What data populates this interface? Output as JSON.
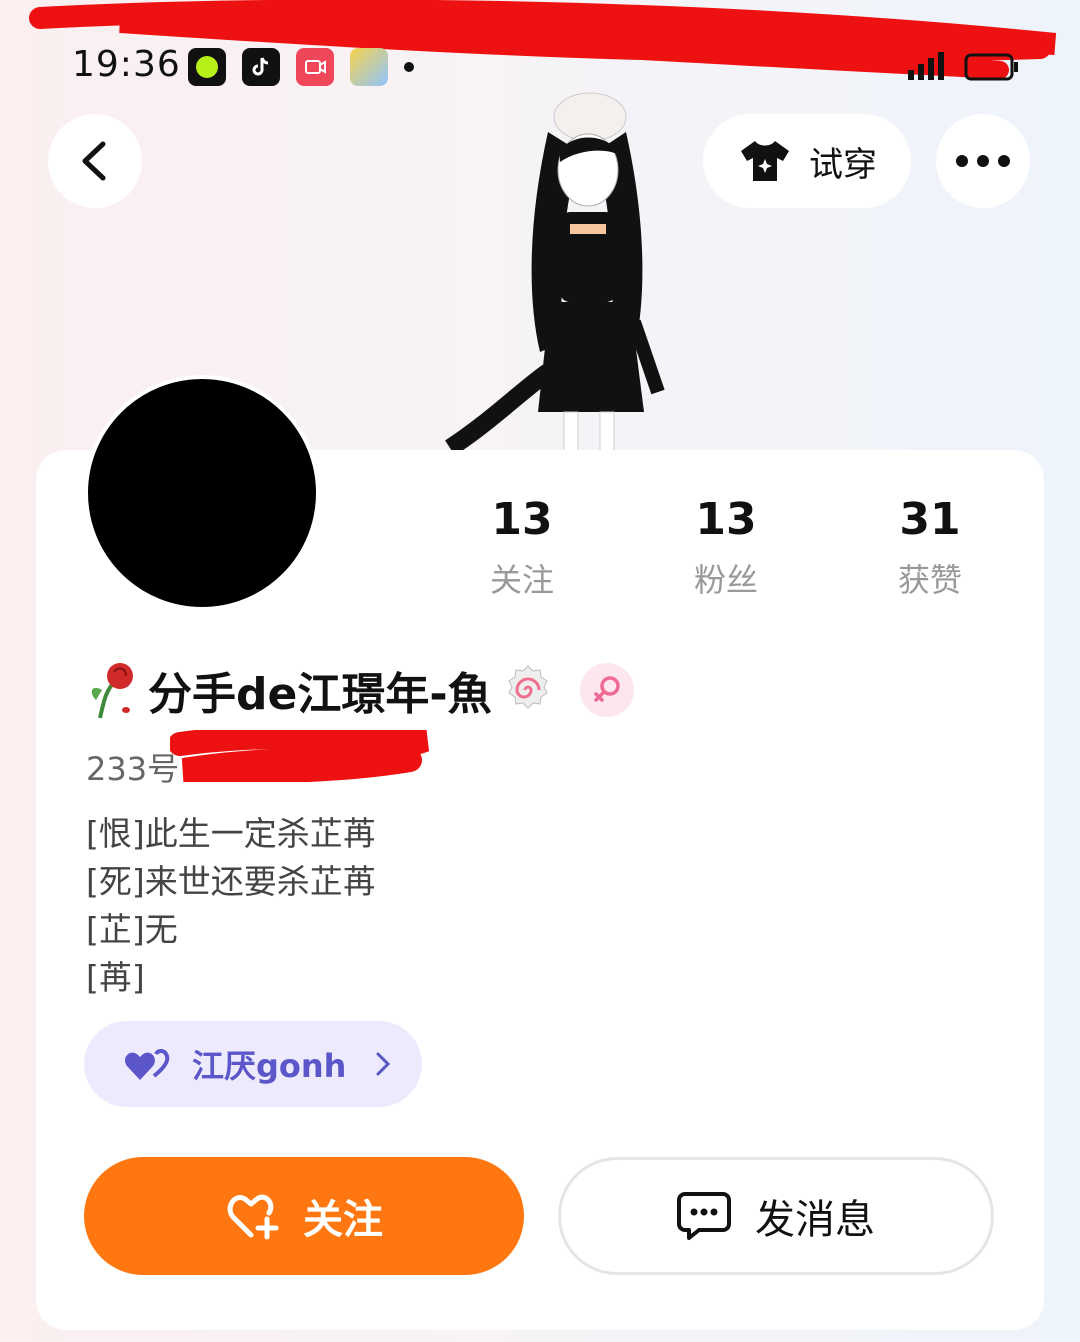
{
  "status_bar": {
    "time": "19:36"
  },
  "header": {
    "tryon_label": "试穿"
  },
  "stats": [
    {
      "value": "13",
      "label": "关注"
    },
    {
      "value": "13",
      "label": "粉丝"
    },
    {
      "value": "31",
      "label": "获赞"
    }
  ],
  "profile": {
    "name": "分手de江璟年-魚",
    "uid_prefix": "233号",
    "bio": [
      "[恨]此生一定杀芷苒",
      "[死]来世还要杀芷苒",
      "[芷]无",
      "[苒]"
    ],
    "tag_label": "江厌gonh"
  },
  "actions": {
    "follow_label": "关注",
    "message_label": "发消息"
  },
  "colors": {
    "accent": "#fe7711",
    "tag_bg": "#eceafc",
    "tag_text": "#5b56c9"
  }
}
